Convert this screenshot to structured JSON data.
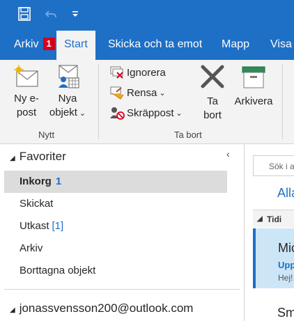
{
  "colors": {
    "accent": "#1e6fc6",
    "ribbon_bg": "#f3f3f3",
    "selected_bg": "#dcdcdc",
    "badge": "#d6001c",
    "message_selected": "#cde6f7"
  },
  "quick_access": {
    "icons": [
      "save-icon",
      "undo-icon",
      "customize-toolbar-icon"
    ]
  },
  "tabs": {
    "file": {
      "label": "Arkiv",
      "badge": "1"
    },
    "items": [
      {
        "label": "Start"
      },
      {
        "label": "Skicka och ta emot"
      },
      {
        "label": "Mapp"
      },
      {
        "label": "Visa"
      }
    ]
  },
  "ribbon": {
    "new_group": {
      "label": "Nytt",
      "new_email": {
        "line1": "Ny e-",
        "line2": "post",
        "icon": "new-email-icon"
      },
      "new_items": {
        "line1": "Nya",
        "line2": "objekt",
        "icon": "new-items-icon"
      }
    },
    "delete_group": {
      "label": "Ta bort",
      "ignore": {
        "label": "Ignorera",
        "icon": "ignore-icon"
      },
      "cleanup": {
        "label": "Rensa",
        "icon": "cleanup-icon"
      },
      "junk": {
        "label": "Skräppost",
        "icon": "junk-icon"
      },
      "delete": {
        "line1": "Ta",
        "line2": "bort",
        "icon": "delete-icon"
      },
      "archive": {
        "label": "Arkivera",
        "icon": "archive-icon"
      }
    }
  },
  "nav": {
    "favorites_label": "Favoriter",
    "items": [
      {
        "label": "Inkorg",
        "count": "1"
      },
      {
        "label": "Skickat",
        "count": ""
      },
      {
        "label": "Utkast",
        "count": "[1]"
      },
      {
        "label": "Arkiv",
        "count": ""
      },
      {
        "label": "Borttagna objekt",
        "count": ""
      }
    ],
    "account_label": "jonassvensson200@outlook.com"
  },
  "list": {
    "search_placeholder": "Sök i a",
    "filter_all": "Alla",
    "group_header": "Tidi",
    "selected_message": {
      "from": "Mic",
      "subject": "Upp",
      "preview": "Hej!"
    },
    "next_message": {
      "from": "Sm"
    }
  }
}
